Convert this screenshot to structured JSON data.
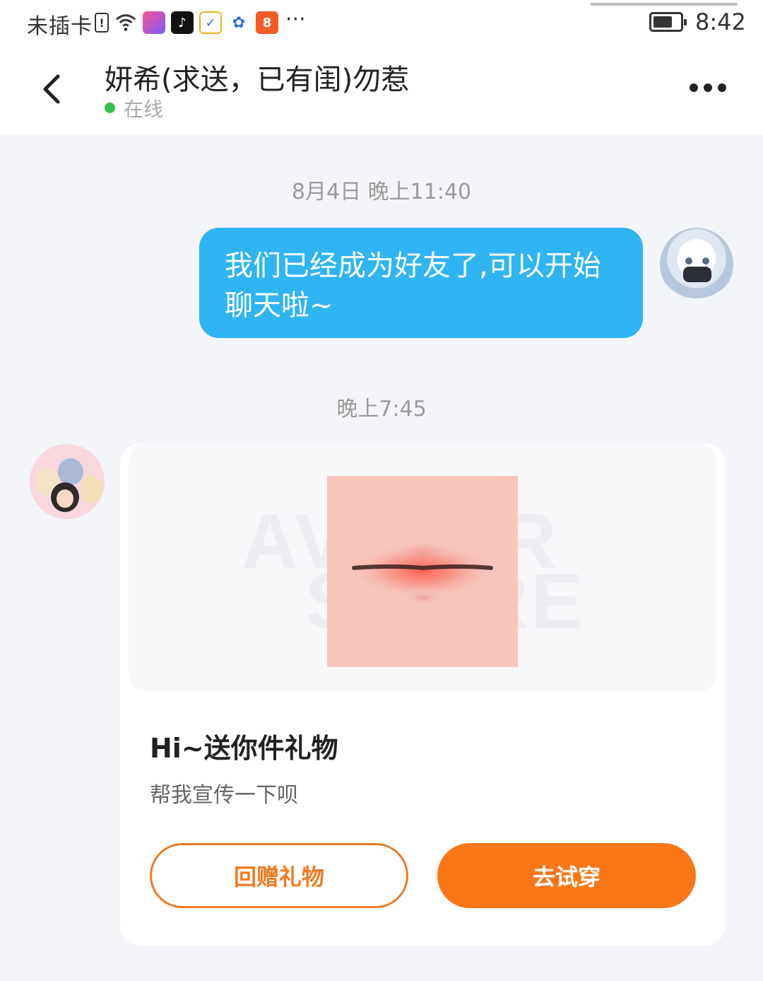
{
  "status_bar": {
    "carrier": "未插卡",
    "more": "···",
    "time": "8:42",
    "icons": [
      "sim-alert-icon",
      "wifi-icon",
      "app-icon-1",
      "tiktok-icon",
      "app-icon-2",
      "baidu-icon",
      "app-icon-3"
    ]
  },
  "header": {
    "title": "妍希(求送，已有闺)勿惹",
    "status": "在线",
    "status_color": "#33c04a"
  },
  "chat": {
    "timestamp_1": "8月4日 晚上11:40",
    "message_1": "我们已经成为好友了,可以开始聊天啦~",
    "timestamp_2": "晚上7:45",
    "bubble_color": "#2fb4f4"
  },
  "gift_card": {
    "watermark_line1": "AVATAR",
    "watermark_line2": "STORE",
    "title": "Hi~送你件礼物",
    "subtitle": "帮我宣传一下呗",
    "return_gift_label": "回赠礼物",
    "try_on_label": "去试穿",
    "accent_color": "#f97716"
  }
}
